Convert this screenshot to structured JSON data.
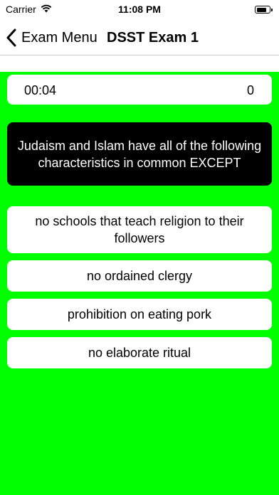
{
  "status_bar": {
    "carrier": "Carrier",
    "time": "11:08 PM"
  },
  "nav": {
    "back_label": "Exam Menu",
    "title": "DSST Exam 1"
  },
  "quiz": {
    "timer": "00:04",
    "score": "0",
    "question": "Judaism and Islam have all of the following characteristics in common EXCEPT",
    "answers": [
      "no schools that teach religion to their followers",
      "no ordained clergy",
      "prohibition on eating pork",
      "no elaborate ritual"
    ]
  },
  "colors": {
    "background": "#00ff00",
    "question_bg": "#000000",
    "answer_bg": "#ffffff"
  },
  "icons": {
    "wifi": "wifi-icon",
    "battery": "battery-icon",
    "back": "chevron-left-icon"
  }
}
